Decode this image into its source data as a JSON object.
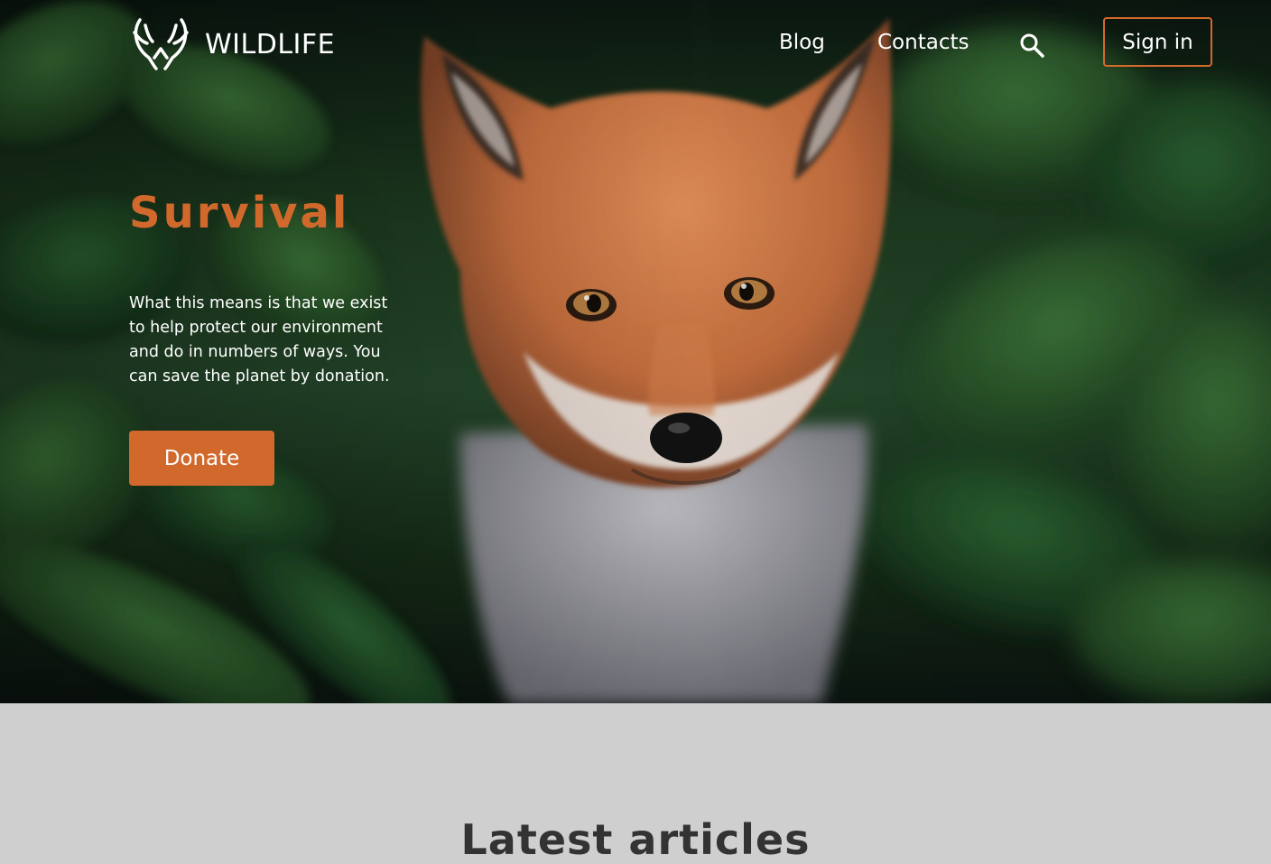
{
  "brand": {
    "name": "WILDLIFE",
    "logo_icon": "antlers-icon"
  },
  "nav": {
    "links": [
      {
        "label": "Blog"
      },
      {
        "label": "Contacts"
      }
    ],
    "search_icon": "search-icon",
    "signin_label": "Sign in"
  },
  "hero": {
    "title": "Survival",
    "text": "What this means is that we exist to help protect our environment and do in numbers of ways. You can save the planet by donation.",
    "cta_label": "Donate",
    "image_subject": "fox-in-foliage"
  },
  "articles": {
    "title": "Latest articles"
  },
  "colors": {
    "accent": "#d2692c",
    "nav_text": "#ffffff",
    "section_bg": "#cfcfcf",
    "section_title": "#333333"
  }
}
